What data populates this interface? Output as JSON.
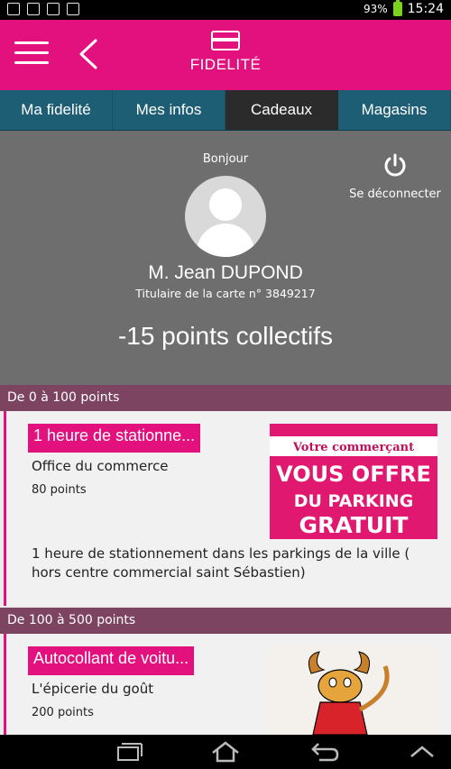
{
  "status": {
    "battery": "93%",
    "time": "15:24"
  },
  "app": {
    "title": "FIDELITÉ"
  },
  "tabs": [
    {
      "label": "Ma fidelité"
    },
    {
      "label": "Mes infos"
    },
    {
      "label": "Cadeaux"
    },
    {
      "label": "Magasins"
    }
  ],
  "profile": {
    "greeting": "Bonjour",
    "name": "M. Jean DUPOND",
    "card_info": "Titulaire de la carte n° 3849217",
    "points": "-15 points collectifs",
    "logout_label": "Se déconnecter"
  },
  "sections": [
    {
      "header": "De 0 à 100 points",
      "item": {
        "title": "1 heure de stationne...",
        "store": "Office du commerce",
        "points": "80 points",
        "description": "1 heure de stationnement dans les parkings de la ville ( hors centre commercial saint Sébastien)",
        "image_text": [
          "Votre commerçant",
          "VOUS OFFRE",
          "DU PARKING",
          "GRATUIT"
        ]
      }
    },
    {
      "header": "De 100 à 500 points",
      "item": {
        "title": "Autocollant de voitu...",
        "store": "L'épicerie du goût",
        "points": "200 points"
      }
    }
  ],
  "icons": {
    "menu": "hamburger-icon",
    "back": "back-chevron-icon",
    "card": "card-icon",
    "power": "power-icon",
    "avatar": "user-avatar-icon"
  },
  "colors": {
    "brand": "#e3117e",
    "tabs": "#1e5e74",
    "section": "#7d4461"
  }
}
